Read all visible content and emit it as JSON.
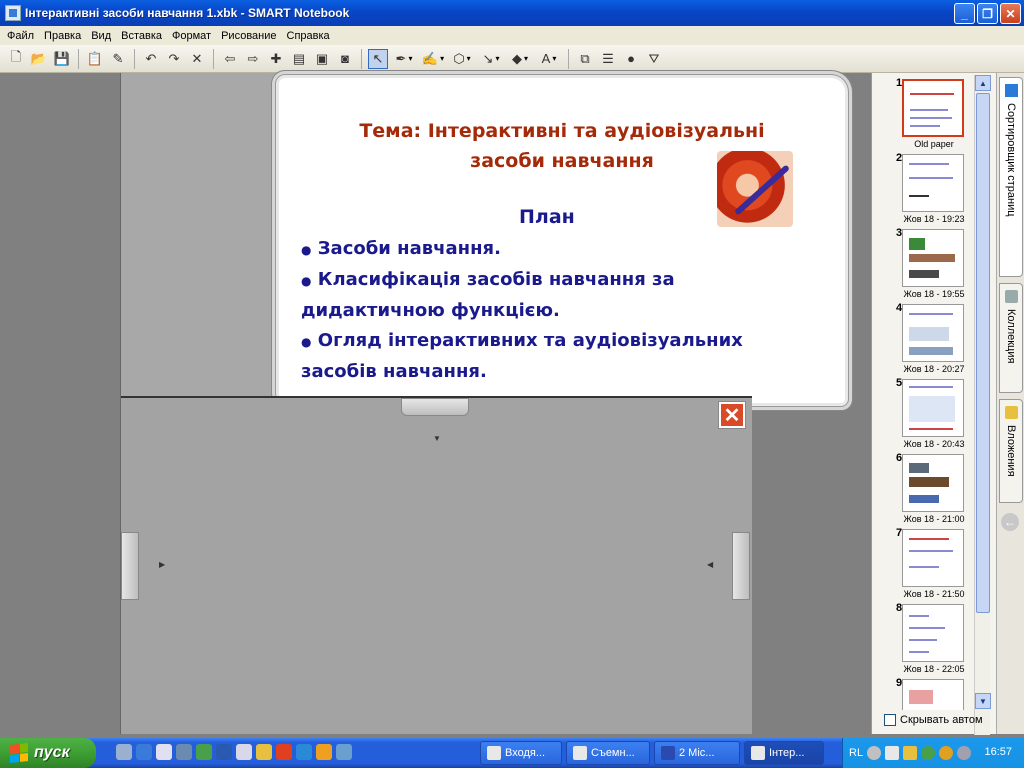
{
  "window": {
    "title": "Інтерактивні засоби навчання 1.xbk - SMART Notebook",
    "min_label": "_",
    "max_label": "❐",
    "close_label": "✕"
  },
  "menu": [
    "Файл",
    "Правка",
    "Вид",
    "Вставка",
    "Формат",
    "Рисование",
    "Справка"
  ],
  "slide": {
    "title_line1": "Тема: Інтерактивні та  аудіовізуальні",
    "title_line2": "засоби навчання",
    "plan_heading": "План",
    "bullet1": "Засоби навчання.",
    "bullet2a": "Класифікація засобів навчання за",
    "bullet2b": "дидактичною функцією.",
    "bullet3a": "Огляд інтерактивних та аудіовізуальних",
    "bullet3b": "засобів навчання.",
    "bullet_glyph": "●"
  },
  "shade": {
    "close_label": "✕"
  },
  "sorter": {
    "pages": [
      {
        "num": "1",
        "caption": "Old paper"
      },
      {
        "num": "2",
        "caption": "Жов 18 - 19:23"
      },
      {
        "num": "3",
        "caption": "Жов 18 - 19:55"
      },
      {
        "num": "4",
        "caption": "Жов 18 - 20:27"
      },
      {
        "num": "5",
        "caption": "Жов 18 - 20:43"
      },
      {
        "num": "6",
        "caption": "Жов 18 - 21:00"
      },
      {
        "num": "7",
        "caption": "Жов 18 - 21:50"
      },
      {
        "num": "8",
        "caption": "Жов 18 - 22:05"
      },
      {
        "num": "9",
        "caption": ""
      }
    ],
    "autohide_label": "Скрывать автом"
  },
  "tabs": {
    "sorter": "Сортировщик страниц",
    "gallery": "Коллекция",
    "attachments": "Вложения"
  },
  "taskbar": {
    "start_label": "пуск",
    "tasks": [
      "Входя...",
      "Съемн...",
      "2 Mic...",
      "Інтер..."
    ],
    "lang": "RL",
    "clock": "16:57"
  }
}
